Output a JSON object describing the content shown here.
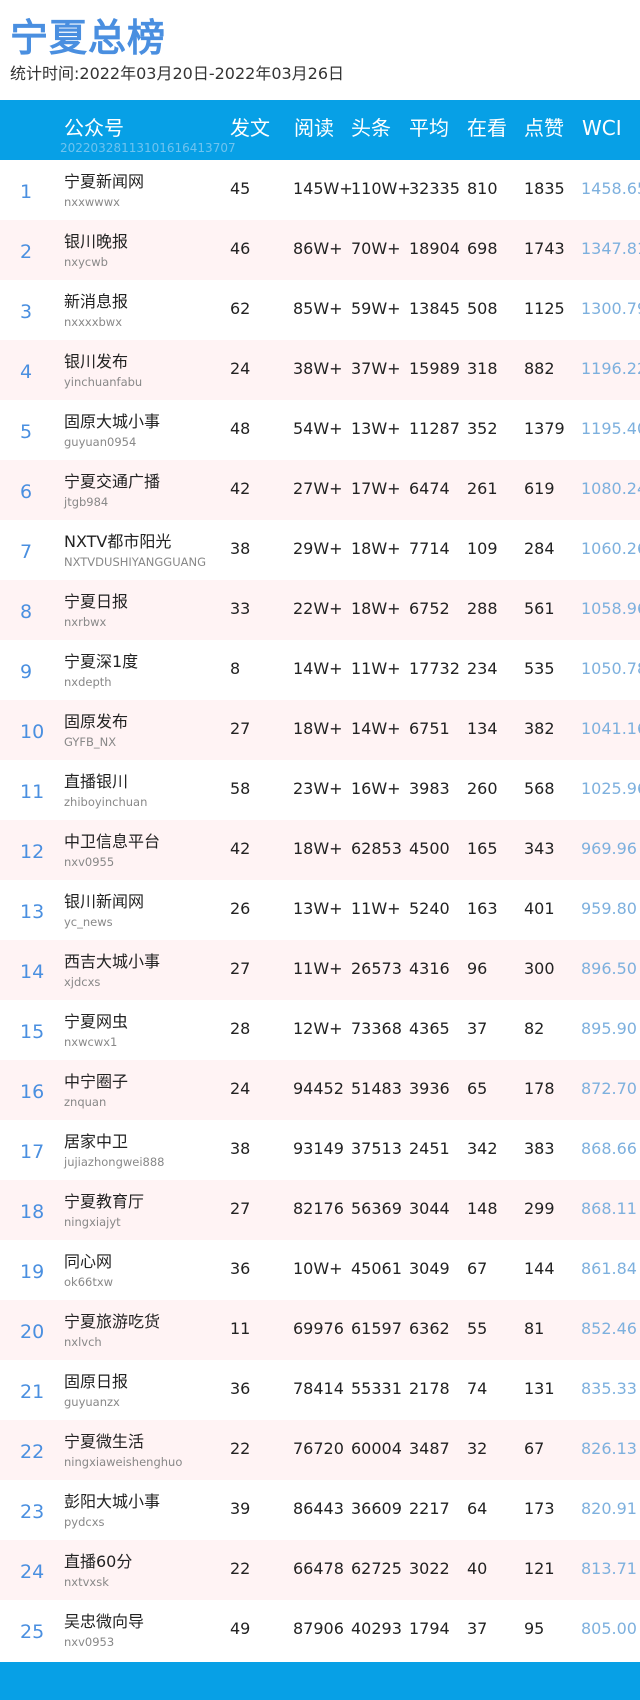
{
  "title": "宁夏总榜",
  "subtitle": "统计时间:2022年03月20日-2022年03月26日",
  "header": {
    "name": "公众号",
    "posts": "发文",
    "reads": "阅读",
    "top": "头条",
    "avg": "平均",
    "watching": "在看",
    "likes": "点赞",
    "wci": "WCI",
    "timestamp_id": "20220328113101616413707"
  },
  "rows": [
    {
      "rank": "1",
      "name": "宁夏新闻网",
      "id": "nxxwwwx",
      "posts": "45",
      "reads": "145W+",
      "top": "110W+",
      "avg": "32335",
      "watching": "810",
      "likes": "1835",
      "wci": "1458.65"
    },
    {
      "rank": "2",
      "name": "银川晚报",
      "id": "nxycwb",
      "posts": "46",
      "reads": "86W+",
      "top": "70W+",
      "avg": "18904",
      "watching": "698",
      "likes": "1743",
      "wci": "1347.81"
    },
    {
      "rank": "3",
      "name": "新消息报",
      "id": "nxxxxbwx",
      "posts": "62",
      "reads": "85W+",
      "top": "59W+",
      "avg": "13845",
      "watching": "508",
      "likes": "1125",
      "wci": "1300.79"
    },
    {
      "rank": "4",
      "name": "银川发布",
      "id": "yinchuanfabu",
      "posts": "24",
      "reads": "38W+",
      "top": "37W+",
      "avg": "15989",
      "watching": "318",
      "likes": "882",
      "wci": "1196.22"
    },
    {
      "rank": "5",
      "name": "固原大城小事",
      "id": "guyuan0954",
      "posts": "48",
      "reads": "54W+",
      "top": "13W+",
      "avg": "11287",
      "watching": "352",
      "likes": "1379",
      "wci": "1195.40"
    },
    {
      "rank": "6",
      "name": "宁夏交通广播",
      "id": "jtgb984",
      "posts": "42",
      "reads": "27W+",
      "top": "17W+",
      "avg": "6474",
      "watching": "261",
      "likes": "619",
      "wci": "1080.24"
    },
    {
      "rank": "7",
      "name": "NXTV都市阳光",
      "id": "NXTVDUSHIYANGGUANG",
      "posts": "38",
      "reads": "29W+",
      "top": "18W+",
      "avg": "7714",
      "watching": "109",
      "likes": "284",
      "wci": "1060.26"
    },
    {
      "rank": "8",
      "name": "宁夏日报",
      "id": "nxrbwx",
      "posts": "33",
      "reads": "22W+",
      "top": "18W+",
      "avg": "6752",
      "watching": "288",
      "likes": "561",
      "wci": "1058.96"
    },
    {
      "rank": "9",
      "name": "宁夏深1度",
      "id": "nxdepth",
      "posts": "8",
      "reads": "14W+",
      "top": "11W+",
      "avg": "17732",
      "watching": "234",
      "likes": "535",
      "wci": "1050.78"
    },
    {
      "rank": "10",
      "name": "固原发布",
      "id": "GYFB_NX",
      "posts": "27",
      "reads": "18W+",
      "top": "14W+",
      "avg": "6751",
      "watching": "134",
      "likes": "382",
      "wci": "1041.16"
    },
    {
      "rank": "11",
      "name": "直播银川",
      "id": "zhiboyinchuan",
      "posts": "58",
      "reads": "23W+",
      "top": "16W+",
      "avg": "3983",
      "watching": "260",
      "likes": "568",
      "wci": "1025.96"
    },
    {
      "rank": "12",
      "name": "中卫信息平台",
      "id": "nxv0955",
      "posts": "42",
      "reads": "18W+",
      "top": "62853",
      "avg": "4500",
      "watching": "165",
      "likes": "343",
      "wci": "969.96"
    },
    {
      "rank": "13",
      "name": "银川新闻网",
      "id": "yc_news",
      "posts": "26",
      "reads": "13W+",
      "top": "11W+",
      "avg": "5240",
      "watching": "163",
      "likes": "401",
      "wci": "959.80"
    },
    {
      "rank": "14",
      "name": "西吉大城小事",
      "id": "xjdcxs",
      "posts": "27",
      "reads": "11W+",
      "top": "26573",
      "avg": "4316",
      "watching": "96",
      "likes": "300",
      "wci": "896.50"
    },
    {
      "rank": "15",
      "name": "宁夏网虫",
      "id": "nxwcwx1",
      "posts": "28",
      "reads": "12W+",
      "top": "73368",
      "avg": "4365",
      "watching": "37",
      "likes": "82",
      "wci": "895.90"
    },
    {
      "rank": "16",
      "name": "中宁圈子",
      "id": "znquan",
      "posts": "24",
      "reads": "94452",
      "top": "51483",
      "avg": "3936",
      "watching": "65",
      "likes": "178",
      "wci": "872.70"
    },
    {
      "rank": "17",
      "name": "居家中卫",
      "id": "jujiazhongwei888",
      "posts": "38",
      "reads": "93149",
      "top": "37513",
      "avg": "2451",
      "watching": "342",
      "likes": "383",
      "wci": "868.66"
    },
    {
      "rank": "18",
      "name": "宁夏教育厅",
      "id": "ningxiajyt",
      "posts": "27",
      "reads": "82176",
      "top": "56369",
      "avg": "3044",
      "watching": "148",
      "likes": "299",
      "wci": "868.11"
    },
    {
      "rank": "19",
      "name": "同心网",
      "id": "ok66txw",
      "posts": "36",
      "reads": "10W+",
      "top": "45061",
      "avg": "3049",
      "watching": "67",
      "likes": "144",
      "wci": "861.84"
    },
    {
      "rank": "20",
      "name": "宁夏旅游吃货",
      "id": "nxlvch",
      "posts": "11",
      "reads": "69976",
      "top": "61597",
      "avg": "6362",
      "watching": "55",
      "likes": "81",
      "wci": "852.46"
    },
    {
      "rank": "21",
      "name": "固原日报",
      "id": "guyuanzx",
      "posts": "36",
      "reads": "78414",
      "top": "55331",
      "avg": "2178",
      "watching": "74",
      "likes": "131",
      "wci": "835.33"
    },
    {
      "rank": "22",
      "name": "宁夏微生活",
      "id": "ningxiaweishenghuo",
      "posts": "22",
      "reads": "76720",
      "top": "60004",
      "avg": "3487",
      "watching": "32",
      "likes": "67",
      "wci": "826.13"
    },
    {
      "rank": "23",
      "name": "彭阳大城小事",
      "id": "pydcxs",
      "posts": "39",
      "reads": "86443",
      "top": "36609",
      "avg": "2217",
      "watching": "64",
      "likes": "173",
      "wci": "820.91"
    },
    {
      "rank": "24",
      "name": "直播60分",
      "id": "nxtvxsk",
      "posts": "22",
      "reads": "66478",
      "top": "62725",
      "avg": "3022",
      "watching": "40",
      "likes": "121",
      "wci": "813.71"
    },
    {
      "rank": "25",
      "name": "吴忠微向导",
      "id": "nxv0953",
      "posts": "49",
      "reads": "87906",
      "top": "40293",
      "avg": "1794",
      "watching": "37",
      "likes": "95",
      "wci": "805.00"
    }
  ]
}
